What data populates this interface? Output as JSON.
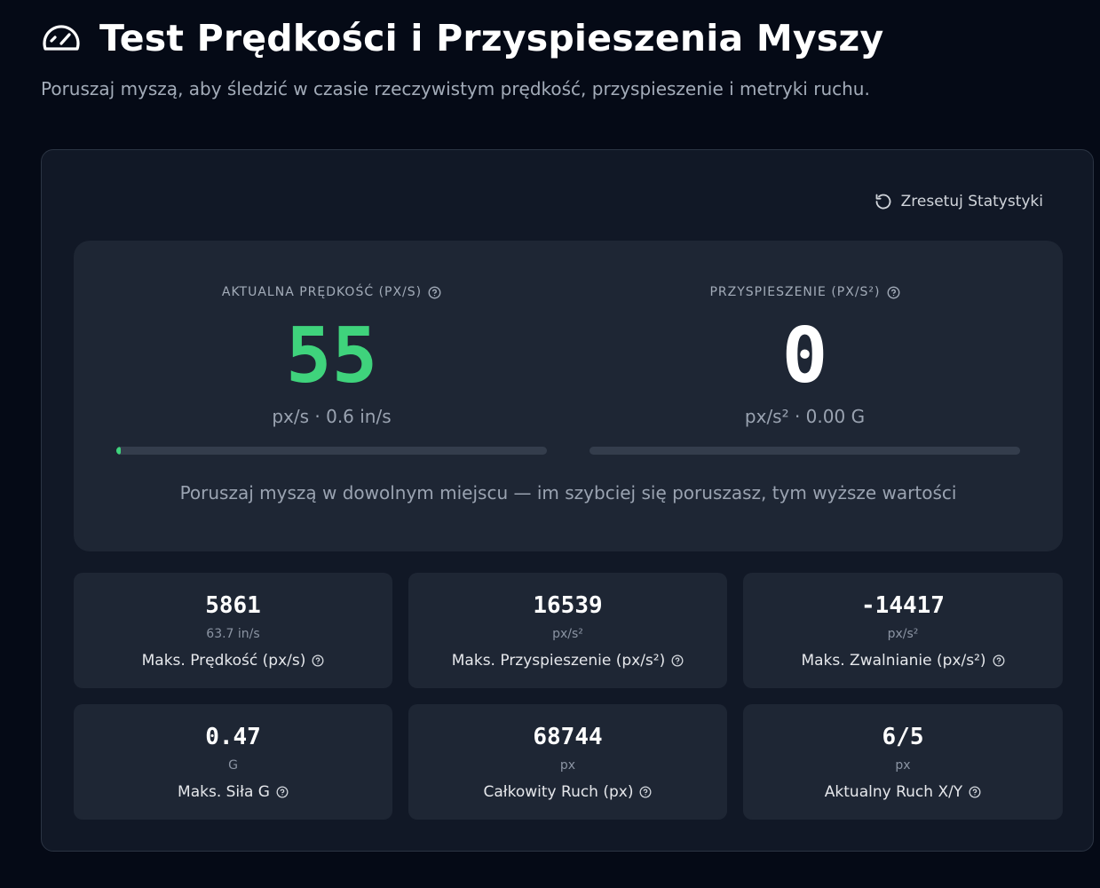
{
  "header": {
    "icon": "gauge-icon",
    "title": "Test Prędkości i Przyspieszenia Myszy",
    "subtitle": "Poruszaj myszą, aby śledzić w czasie rzeczywistym prędkość, przyspieszenie i metryki ruchu."
  },
  "toolbar": {
    "reset_label": "Zresetuj Statystyki",
    "reset_icon": "rotate-ccw-icon"
  },
  "meters": {
    "speed": {
      "label": "AKTUALNA PRĘDKOŚĆ (PX/S)",
      "value": "55",
      "unit": "px/s · 0.6 in/s",
      "fill_fraction": 0.01,
      "value_color": "#3fd37c"
    },
    "acceleration": {
      "label": "PRZYSPIESZENIE (PX/S²)",
      "value": "0",
      "unit": "px/s² · 0.00 G",
      "fill_fraction": 0.0,
      "value_color": "#ffffff"
    },
    "hint": "Poruszaj myszą w dowolnym miejscu — im szybciej się poruszasz, tym wyższe wartości"
  },
  "stats": [
    {
      "value": "5861",
      "sub": "63.7 in/s",
      "label": "Maks. Prędkość (px/s)"
    },
    {
      "value": "16539",
      "sub": "px/s²",
      "label": "Maks. Przyspieszenie (px/s²)"
    },
    {
      "value": "-14417",
      "sub": "px/s²",
      "label": "Maks. Zwalnianie (px/s²)"
    },
    {
      "value": "0.47",
      "sub": "G",
      "label": "Maks. Siła G"
    },
    {
      "value": "68744",
      "sub": "px",
      "label": "Całkowity Ruch (px)"
    },
    {
      "value": "6/5",
      "sub": "px",
      "label": "Aktualny Ruch X/Y"
    }
  ],
  "colors": {
    "background": "#050a16",
    "panel": "#111826",
    "card": "#1e2634",
    "accent_green": "#3fd37c",
    "muted_text": "#9aa3b1"
  }
}
